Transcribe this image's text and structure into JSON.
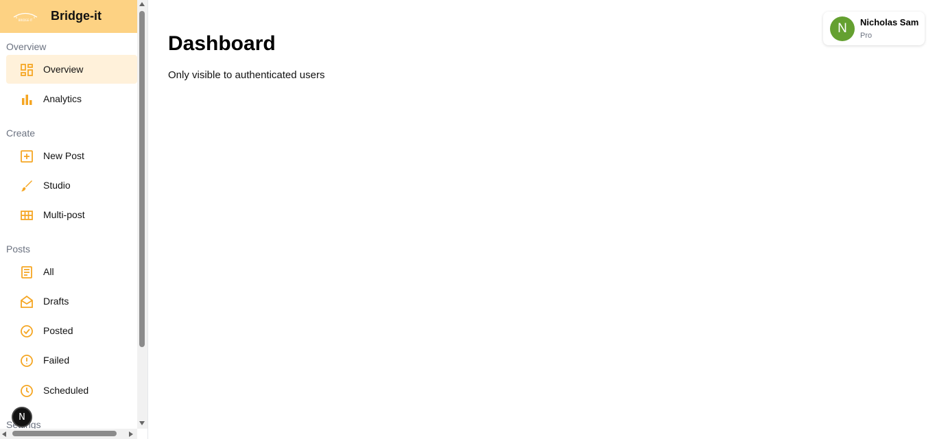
{
  "brand": {
    "title": "Bridge-it",
    "logo_text": "BRIDGE-IT"
  },
  "sidebar": {
    "sections": [
      {
        "label": "Overview",
        "items": [
          {
            "label": "Overview",
            "icon": "grid-icon",
            "active": true
          },
          {
            "label": "Analytics",
            "icon": "bar-chart-icon"
          }
        ]
      },
      {
        "label": "Create",
        "items": [
          {
            "label": "New Post",
            "icon": "plus-square-icon"
          },
          {
            "label": "Studio",
            "icon": "brush-icon"
          },
          {
            "label": "Multi-post",
            "icon": "table-icon"
          }
        ]
      },
      {
        "label": "Posts",
        "items": [
          {
            "label": "All",
            "icon": "document-list-icon"
          },
          {
            "label": "Drafts",
            "icon": "open-mail-icon"
          },
          {
            "label": "Posted",
            "icon": "check-circle-icon"
          },
          {
            "label": "Failed",
            "icon": "alert-circle-icon"
          },
          {
            "label": "Scheduled",
            "icon": "clock-icon"
          }
        ]
      },
      {
        "label": "Settings"
      }
    ],
    "badge": "N"
  },
  "main": {
    "title": "Dashboard",
    "subtitle": "Only visible to authenticated users"
  },
  "user": {
    "initial": "N",
    "name": "Nicholas Sam",
    "plan": "Pro"
  },
  "colors": {
    "accent": "#f5a623",
    "brand_bg": "#fdd283",
    "active_bg": "#fff1da",
    "avatar_bg": "#64a030"
  }
}
